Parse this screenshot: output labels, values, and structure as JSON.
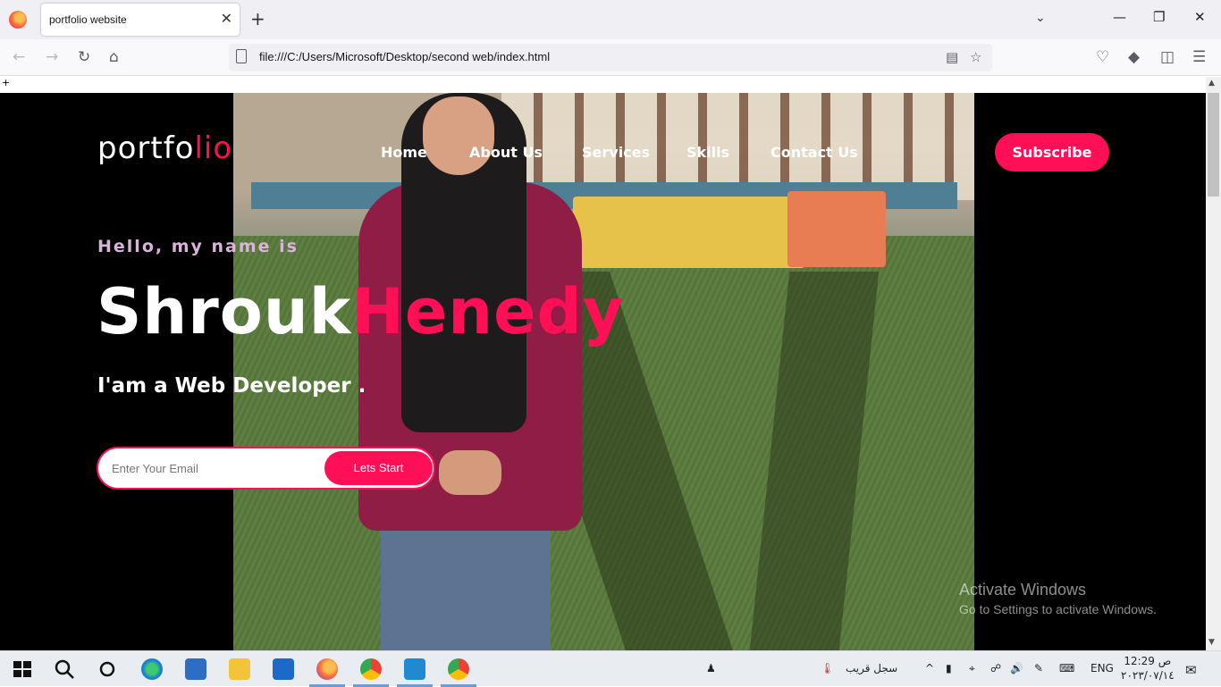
{
  "browser": {
    "tab_title": "portfolio website",
    "tab_close": "✕",
    "new_tab": "+",
    "url": "file:///C:/Users/Microsoft/Desktop/second web/index.html",
    "page_strip_text": "+"
  },
  "site": {
    "logo_main": "portfo",
    "logo_accent": "lio",
    "nav": [
      "Home",
      "About Us",
      "Services",
      "Skills",
      "Contact Us"
    ],
    "subscribe_label": "Subscribe",
    "hello": "Hello, my name is",
    "first_name": "Shrouk",
    "last_name": "Henedy",
    "role": "I'am a Web Developer .",
    "email_placeholder": "Enter Your Email",
    "start_label": "Lets Start",
    "accent_color": "#ff0f55"
  },
  "overlay": {
    "activate_title": "Activate Windows",
    "activate_sub": "Go to Settings to activate Windows."
  },
  "taskbar": {
    "weather_text": "سجل قريب",
    "lang": "ENG",
    "time": "12:29 ص",
    "date": "٢٠٢٣/٠٧/١٤"
  }
}
